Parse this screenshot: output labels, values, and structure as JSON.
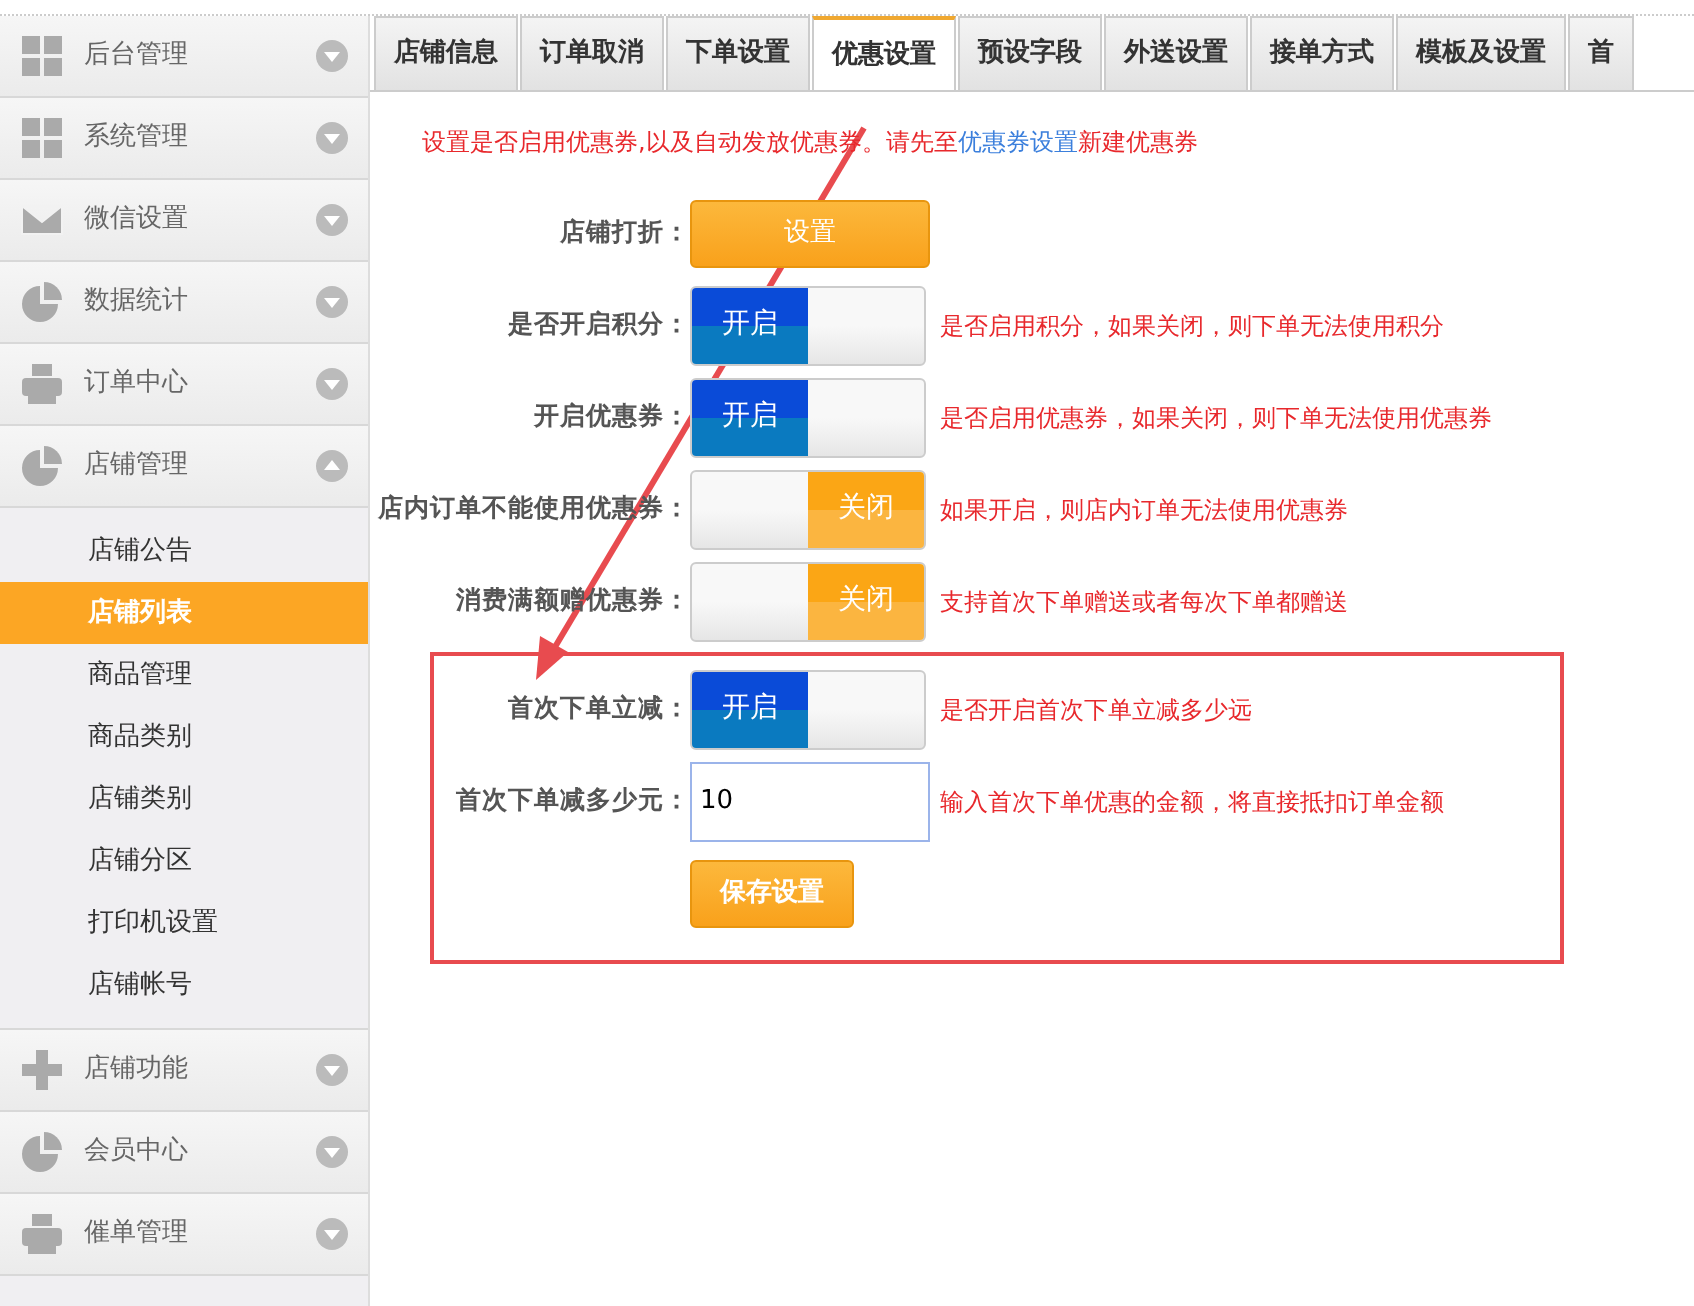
{
  "sidebar": {
    "items": [
      {
        "label": "后台管理",
        "expanded": false
      },
      {
        "label": "系统管理",
        "expanded": false
      },
      {
        "label": "微信设置",
        "expanded": false
      },
      {
        "label": "数据统计",
        "expanded": false
      },
      {
        "label": "订单中心",
        "expanded": false
      },
      {
        "label": "店铺管理",
        "expanded": true,
        "children": [
          {
            "label": "店铺公告",
            "selected": false
          },
          {
            "label": "店铺列表",
            "selected": true
          },
          {
            "label": "商品管理",
            "selected": false
          },
          {
            "label": "商品类别",
            "selected": false
          },
          {
            "label": "店铺类别",
            "selected": false
          },
          {
            "label": "店铺分区",
            "selected": false
          },
          {
            "label": "打印机设置",
            "selected": false
          },
          {
            "label": "店铺帐号",
            "selected": false
          }
        ]
      },
      {
        "label": "店铺功能",
        "expanded": false
      },
      {
        "label": "会员中心",
        "expanded": false
      },
      {
        "label": "催单管理",
        "expanded": false
      }
    ]
  },
  "tabs": [
    {
      "label": "店铺信息",
      "selected": false
    },
    {
      "label": "订单取消",
      "selected": false
    },
    {
      "label": "下单设置",
      "selected": false
    },
    {
      "label": "优惠设置",
      "selected": true
    },
    {
      "label": "预设字段",
      "selected": false
    },
    {
      "label": "外送设置",
      "selected": false
    },
    {
      "label": "接单方式",
      "selected": false
    },
    {
      "label": "模板及设置",
      "selected": false
    },
    {
      "label": "首",
      "selected": false
    }
  ],
  "notice": {
    "before": "设置是否启用优惠券,以及自动发放优惠券。请先至",
    "link": "优惠券设置",
    "after": "新建优惠券"
  },
  "form": {
    "rows": [
      {
        "kind": "button",
        "label": "店铺打折：",
        "button": "设置"
      },
      {
        "kind": "toggle",
        "label": "是否开启积分：",
        "on": true,
        "text": "开启",
        "hint": "是否启用积分，如果关闭，则下单无法使用积分"
      },
      {
        "kind": "toggle",
        "label": "开启优惠券：",
        "on": true,
        "text": "开启",
        "hint": "是否启用优惠券，如果关闭，则下单无法使用优惠券"
      },
      {
        "kind": "toggle",
        "label": "店内订单不能使用优惠券：",
        "on": false,
        "text": "关闭",
        "hint": "如果开启，则店内订单无法使用优惠券"
      },
      {
        "kind": "toggle",
        "label": "消费满额赠优惠券：",
        "on": false,
        "text": "关闭",
        "hint": "支持首次下单赠送或者每次下单都赠送"
      },
      {
        "kind": "toggle",
        "label": "首次下单立减：",
        "on": true,
        "text": "开启",
        "hint": "是否开启首次下单立减多少远",
        "highlighted": true
      },
      {
        "kind": "input",
        "label": "首次下单减多少元：",
        "value": "10",
        "hint": "输入首次下单优惠的金额，将直接抵扣订单金额",
        "highlighted": true
      }
    ],
    "save_button": "保存设置"
  }
}
